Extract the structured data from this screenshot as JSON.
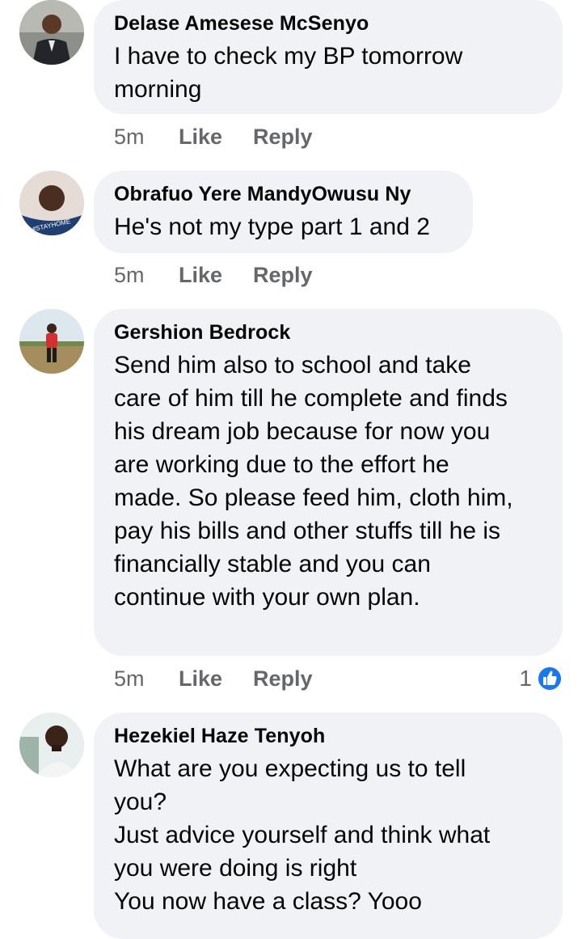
{
  "comments": [
    {
      "author": "Delase Amesese McSenyo",
      "text": "I have to check my BP tomorrow\nmorning",
      "time": "5m",
      "like_label": "Like",
      "reply_label": "Reply"
    },
    {
      "author": "Obrafuo Yere MandyOwusu Ny",
      "text": "He's not my type part 1 and 2",
      "time": "5m",
      "like_label": "Like",
      "reply_label": "Reply",
      "avatar_caption": "#STAYHOME"
    },
    {
      "author": "Gershion Bedrock",
      "text": "Send him also to school and take\ncare of him till he complete and finds\nhis dream job because for now you\nare working due to the effort he\nmade. So please feed him, cloth him,\npay his bills and other stuffs till he is\nfinancially stable and you can\ncontinue with your own plan.",
      "time": "5m",
      "like_label": "Like",
      "reply_label": "Reply",
      "reaction_count": "1",
      "reaction_icon": "like-thumb-icon"
    },
    {
      "author": "Hezekiel Haze Tenyoh",
      "text": "What are you expecting us to tell\nyou?\nJust advice yourself and think what\nyou were doing is right\nYou now have a class? Yooo"
    }
  ],
  "colors": {
    "bubble_bg": "#f0f2f5",
    "meta_text": "#65676b",
    "like_blue": "#1877f2"
  }
}
